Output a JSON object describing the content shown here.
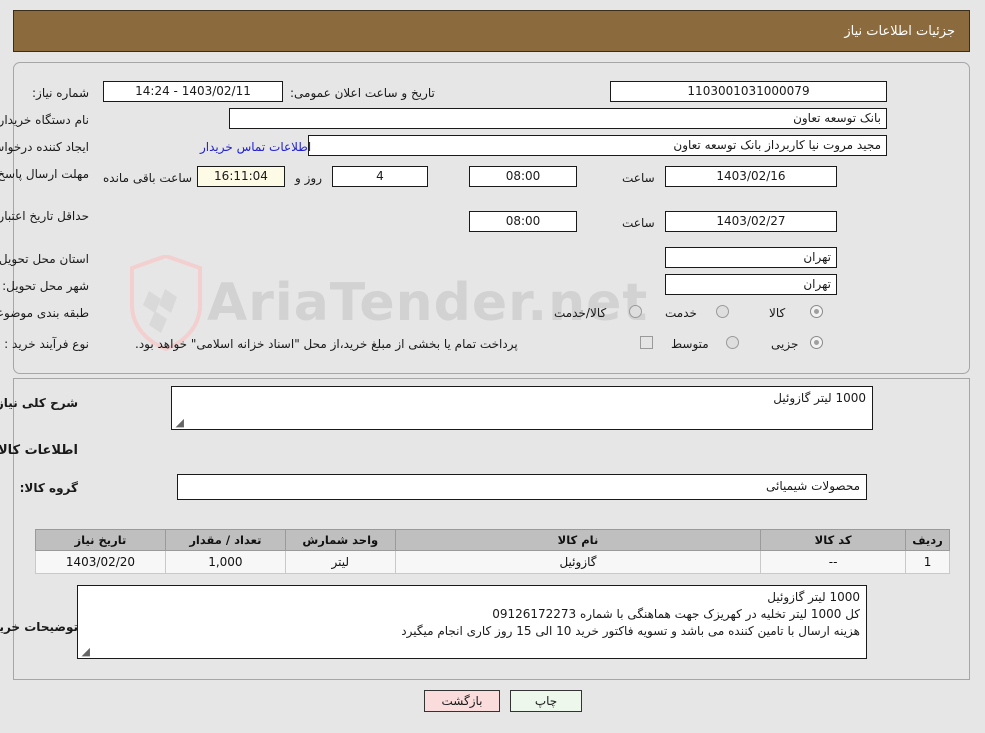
{
  "window": {
    "title": "جزئیات اطلاعات نیاز",
    "header_color": "#8b6b3d"
  },
  "watermark": {
    "text": "AriaTender.net"
  },
  "form": {
    "need_number_label": "شماره نیاز:",
    "need_number_value": "1103001031000079",
    "announce_label": "تاریخ و ساعت اعلان عمومی:",
    "announce_value": "1403/02/11 - 14:24",
    "buyer_org_label": "نام دستگاه خریدار:",
    "buyer_org_value": "بانک توسعه تعاون",
    "creator_label": "ایجاد کننده درخواست:",
    "creator_value": "مجید مروت نیا کاربرداز بانک توسعه تعاون",
    "contact_link": "اطلاعات تماس خریدار",
    "deadline_label": "مهلت ارسال پاسخ: تا تاریخ:",
    "deadline_date": "1403/02/16",
    "deadline_time_label": "ساعت",
    "deadline_time": "08:00",
    "days_remaining": "4",
    "days_word": "روز و",
    "countdown": "16:11:04",
    "countdown_suffix": "ساعت باقی مانده",
    "validity_label": "حداقل تاریخ اعتبار قیمت: تا تاریخ:",
    "validity_date": "1403/02/27",
    "validity_time_label": "ساعت",
    "validity_time": "08:00",
    "province_label": "استان محل تحویل:",
    "province_value": "تهران",
    "city_label": "شهر محل تحویل:",
    "city_value": "تهران",
    "category_label": "طبقه بندی موضوعی:",
    "category_options": [
      "کالا",
      "خدمت",
      "کالا/خدمت"
    ],
    "category_selected": "کالا",
    "process_label": "نوع فرآیند خرید :",
    "process_options": [
      "جزیی",
      "متوسط"
    ],
    "process_note": "پرداخت تمام یا بخشی از مبلغ خرید،از محل \"اسناد خزانه اسلامی\" خواهد بود."
  },
  "summary": {
    "label": "شرح کلی نیاز:",
    "value": "1000 لیتر گازوئیل"
  },
  "goods_section": {
    "heading": "اطلاعات کالاهای مورد نیاز",
    "group_label": "گروه کالا:",
    "group_value": "محصولات شیمیائی"
  },
  "table": {
    "headers": [
      "ردیف",
      "کد کالا",
      "نام کالا",
      "واحد شمارش",
      "تعداد / مقدار",
      "تاریخ نیاز"
    ],
    "rows": [
      {
        "row": "1",
        "code": "--",
        "name": "گازوئیل",
        "unit": "لیتر",
        "qty": "1,000",
        "date": "1403/02/20"
      }
    ]
  },
  "notes": {
    "label": "توضیحات خریدار:",
    "lines": [
      "1000 لیتر گازوئیل",
      "کل 1000 لیتر تخلیه در کهریزک جهت هماهنگی با شماره 09126172273",
      "هزینه ارسال با تامین کننده می باشد و تسویه فاکتور خرید 10 الی 15 روز کاری انجام میگیرد"
    ]
  },
  "buttons": {
    "print": "چاپ",
    "back": "بازگشت"
  }
}
